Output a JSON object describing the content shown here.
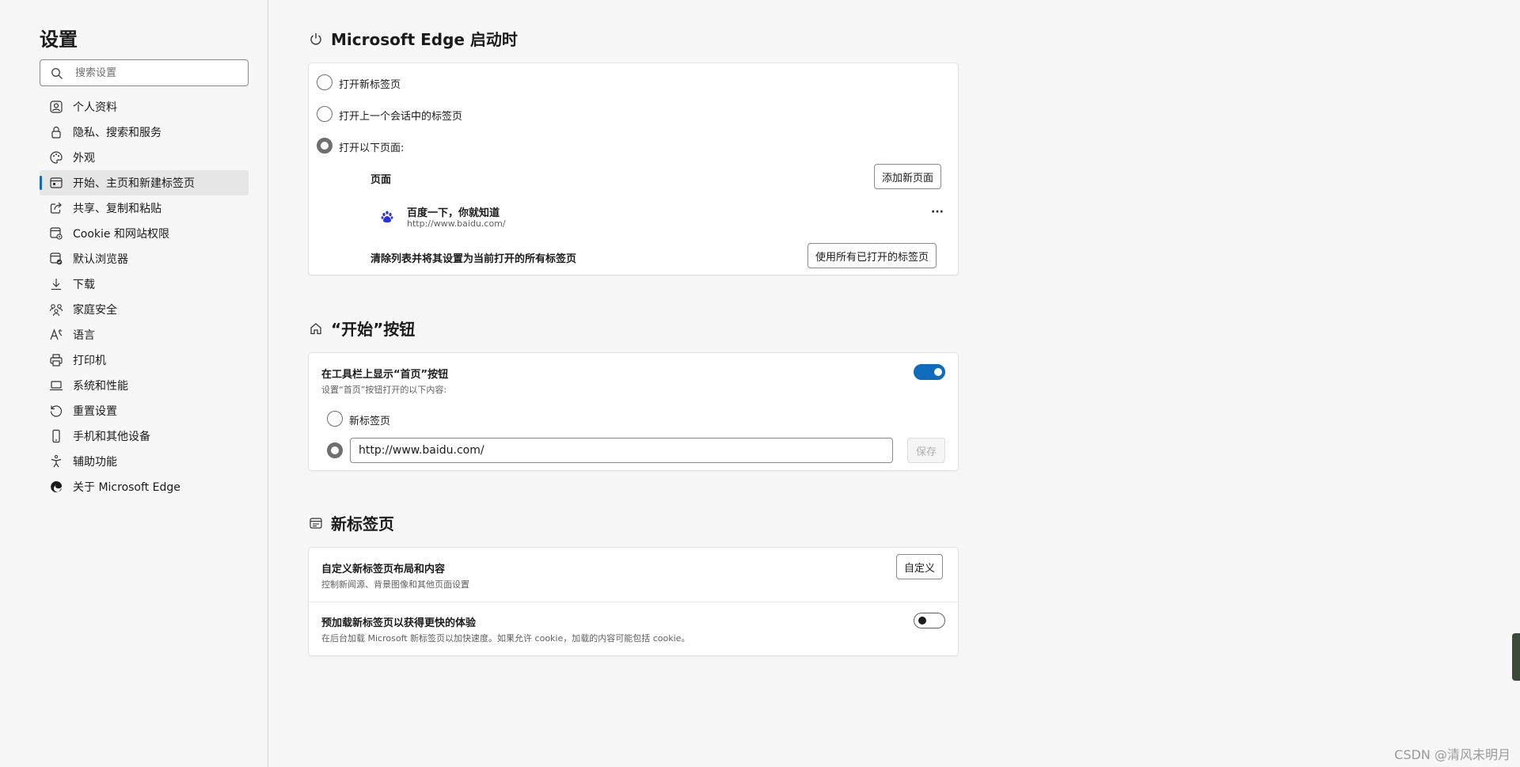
{
  "sidebar": {
    "title": "设置",
    "search_placeholder": "搜索设置",
    "items": [
      {
        "label": "个人资料",
        "icon": "profile-icon"
      },
      {
        "label": "隐私、搜索和服务",
        "icon": "lock-icon"
      },
      {
        "label": "外观",
        "icon": "palette-icon"
      },
      {
        "label": "开始、主页和新建标签页",
        "icon": "start-page-icon",
        "active": true
      },
      {
        "label": "共享、复制和粘贴",
        "icon": "share-icon"
      },
      {
        "label": "Cookie 和网站权限",
        "icon": "site-permissions-icon"
      },
      {
        "label": "默认浏览器",
        "icon": "default-browser-icon"
      },
      {
        "label": "下载",
        "icon": "download-icon"
      },
      {
        "label": "家庭安全",
        "icon": "family-icon"
      },
      {
        "label": "语言",
        "icon": "language-icon"
      },
      {
        "label": "打印机",
        "icon": "printer-icon"
      },
      {
        "label": "系统和性能",
        "icon": "laptop-icon"
      },
      {
        "label": "重置设置",
        "icon": "reset-icon"
      },
      {
        "label": "手机和其他设备",
        "icon": "phone-icon"
      },
      {
        "label": "辅助功能",
        "icon": "accessibility-icon"
      },
      {
        "label": "关于 Microsoft Edge",
        "icon": "edge-logo-icon"
      }
    ]
  },
  "startup": {
    "title": "Microsoft Edge 启动时",
    "icon": "power-icon",
    "option_new_tab": "打开新标签页",
    "option_prev_session": "打开上一个会话中的标签页",
    "option_specific": "打开以下页面:",
    "pages_label": "页面",
    "add_page_button": "添加新页面",
    "page_title": "百度一下，你就知道",
    "page_url": "http://www.baidu.com/",
    "page_icon": "baidu-paw-icon",
    "more_button": "···",
    "clear_label": "清除列表并将其设置为当前打开的所有标签页",
    "use_open_tabs_button": "使用所有已打开的标签页"
  },
  "home_button": {
    "title": "“开始”按钮",
    "icon": "home-icon",
    "show_label": "在工具栏上显示“首页”按钮",
    "show_sub": "设置“首页”按钮打开的以下内容:",
    "toggle_on": true,
    "option_new_tab": "新标签页",
    "url_value": "http://www.baidu.com/",
    "save_button": "保存"
  },
  "new_tab": {
    "title": "新标签页",
    "icon": "new-tab-icon",
    "customize_label": "自定义新标签页布局和内容",
    "customize_sub": "控制新闻源、背景图像和其他页面设置",
    "customize_button": "自定义",
    "preload_label": "预加载新标签页以获得更快的体验",
    "preload_sub": "在后台加载 Microsoft 新标签页以加快速度。如果允许 cookie，加载的内容可能包括 cookie。",
    "preload_on": false
  },
  "watermark": "CSDN @清风未明月",
  "colors": {
    "accent": "#0f6cbd",
    "background": "#f7f7f7"
  }
}
